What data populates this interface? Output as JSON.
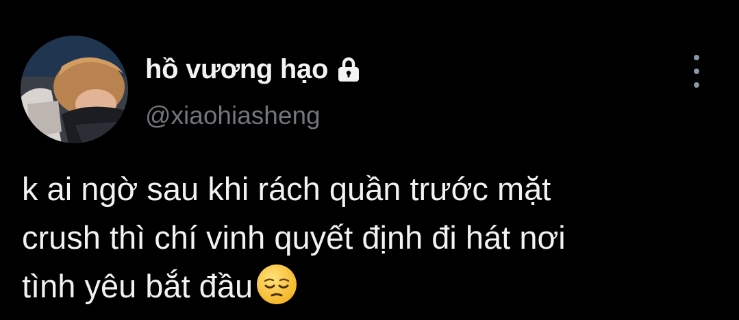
{
  "tweet": {
    "display_name": "hồ vương hạo",
    "handle": "@xiaohiasheng",
    "text_line_1": "k ai ngờ sau khi rách quần trước mặt",
    "text_line_2": "crush thì chí vinh quyết định đi hát nơi",
    "text_line_3": "tình yêu bắt đầu",
    "emoji": "pensive-face",
    "protected_icon": "lock-icon",
    "more_icon": "more-vertical-icon"
  },
  "colors": {
    "background": "#000000",
    "display_name": "#f2f3f4",
    "handle": "#71767b",
    "text": "#f1f2f3",
    "more_icon": "#8b98a5"
  }
}
